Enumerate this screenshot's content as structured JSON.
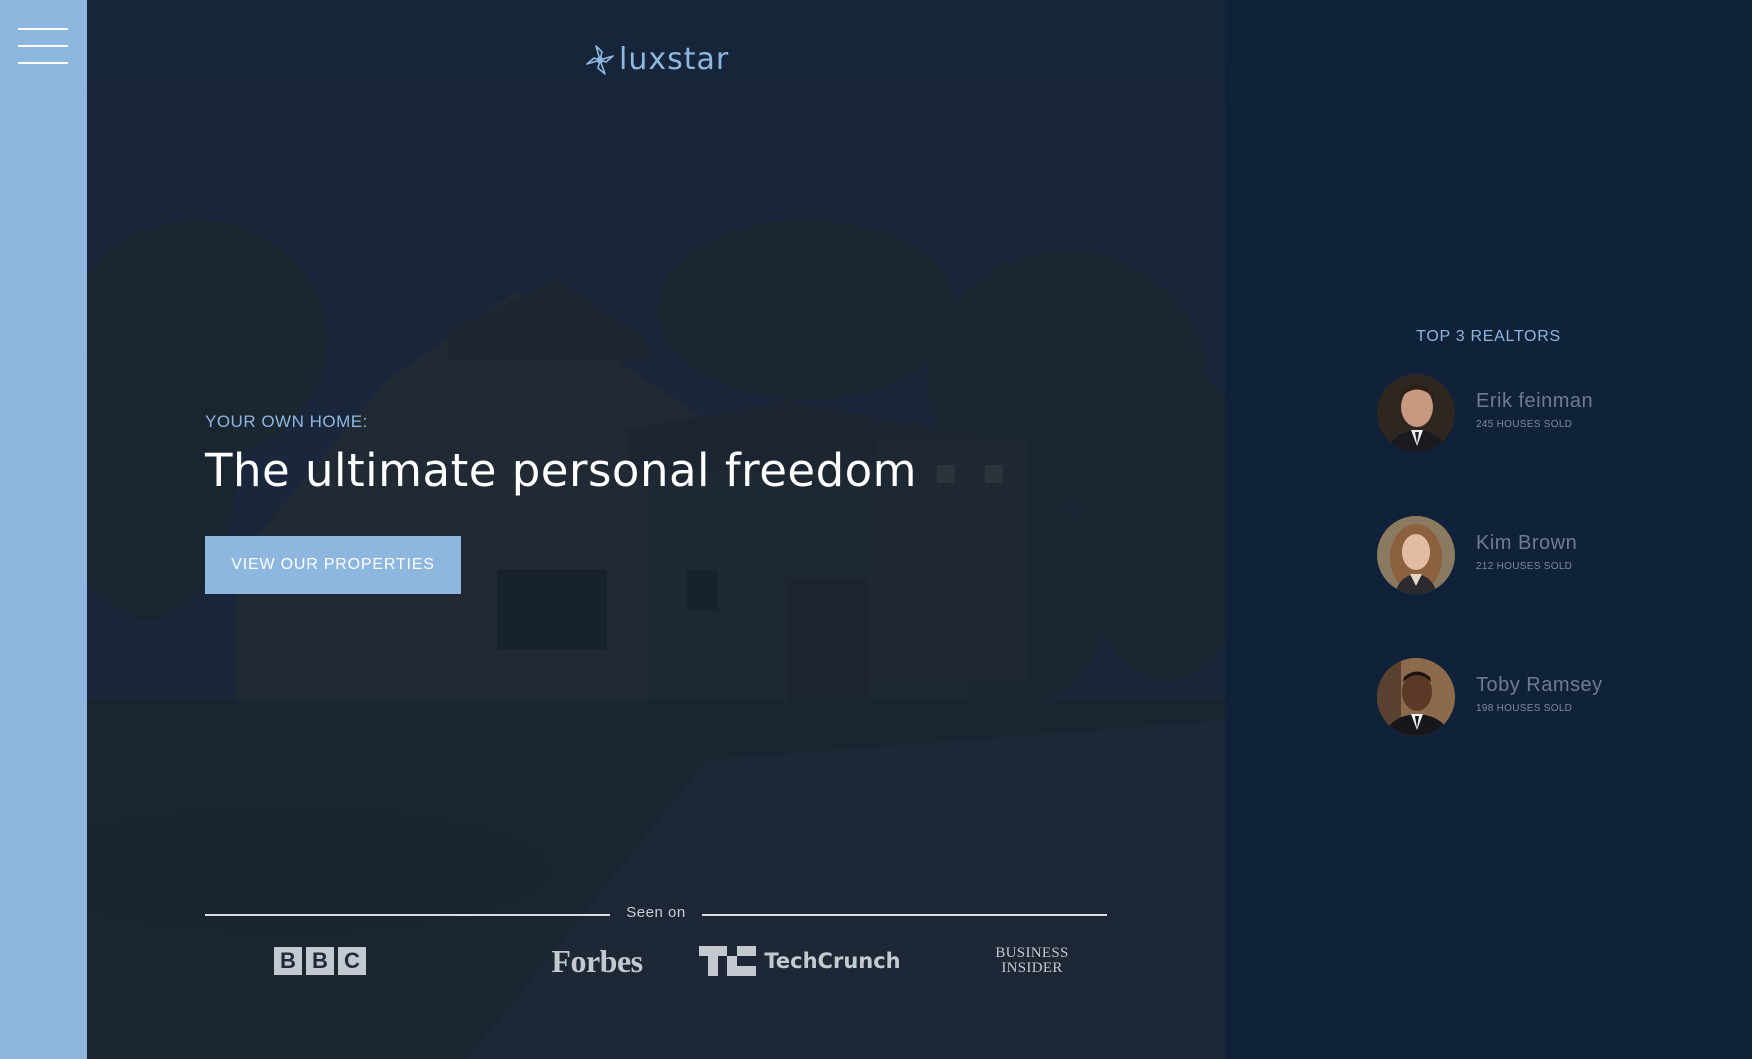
{
  "nav": {
    "menu_icon": "hamburger-menu-icon"
  },
  "brand": {
    "logo_text": "luxstar",
    "logo_icon": "pinwheel-star-icon",
    "accent_color": "#8db7de"
  },
  "hero": {
    "eyebrow": "YOUR OWN HOME:",
    "headline": "The ultimate personal freedom",
    "cta_label": "VIEW OUR PROPERTIES",
    "background": "house-at-dusk-photo"
  },
  "press": {
    "seen_on_label": "Seen on",
    "logos": {
      "bbc": [
        "B",
        "B",
        "C"
      ],
      "forbes": "Forbes",
      "techcrunch": "TechCrunch",
      "business_insider_line1": "Business",
      "business_insider_line2": "Insider"
    }
  },
  "realtors": {
    "title": "TOP 3 REALTORS",
    "items": [
      {
        "name": "Erik feinman",
        "sold": "245 HOUSES SOLD"
      },
      {
        "name": "Kim Brown",
        "sold": "212 HOUSES SOLD"
      },
      {
        "name": "Toby Ramsey",
        "sold": "198 HOUSES SOLD"
      }
    ]
  }
}
